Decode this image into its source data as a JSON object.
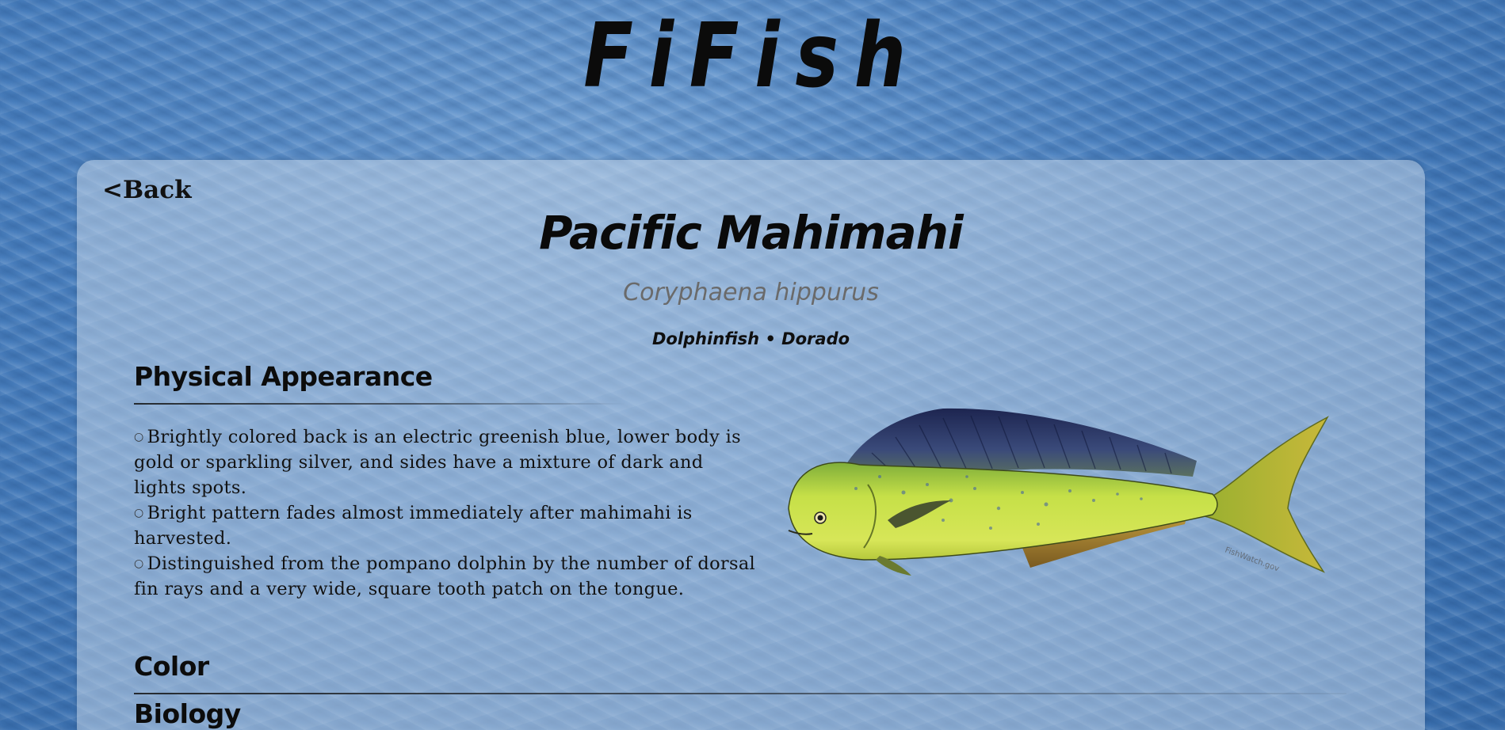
{
  "site": {
    "logo": "FiFish"
  },
  "nav": {
    "back_label": "<Back"
  },
  "fish": {
    "common_name": "Pacific Mahimahi",
    "scientific_name": "Coryphaena hippurus",
    "aliases": "Dolphinfish • Dorado",
    "image_watermark": "FishWatch.gov"
  },
  "sections": {
    "physical_appearance": {
      "heading": "Physical Appearance",
      "bullet_icon": "bullet-icon",
      "items": [
        "Brightly colored back is an electric greenish blue, lower body is gold or sparkling silver, and sides have a mixture of dark and lights spots.",
        "Bright pattern fades almost immediately after mahimahi is harvested.",
        "Distinguished from the pompano dolphin by the number of dorsal fin rays and a very wide, square tooth patch on the tongue."
      ]
    },
    "color": {
      "heading": "Color"
    },
    "biology": {
      "heading": "Biology"
    }
  },
  "colors": {
    "ocean_background": "#4a80bf",
    "card_background": "rgba(200,214,232,0.52)",
    "text_primary": "#0c0c0c",
    "text_muted": "#6a6a6a",
    "fish_back": "#2c3a6e",
    "fish_body": "#c8e04a",
    "fish_fin": "#a88a30"
  }
}
